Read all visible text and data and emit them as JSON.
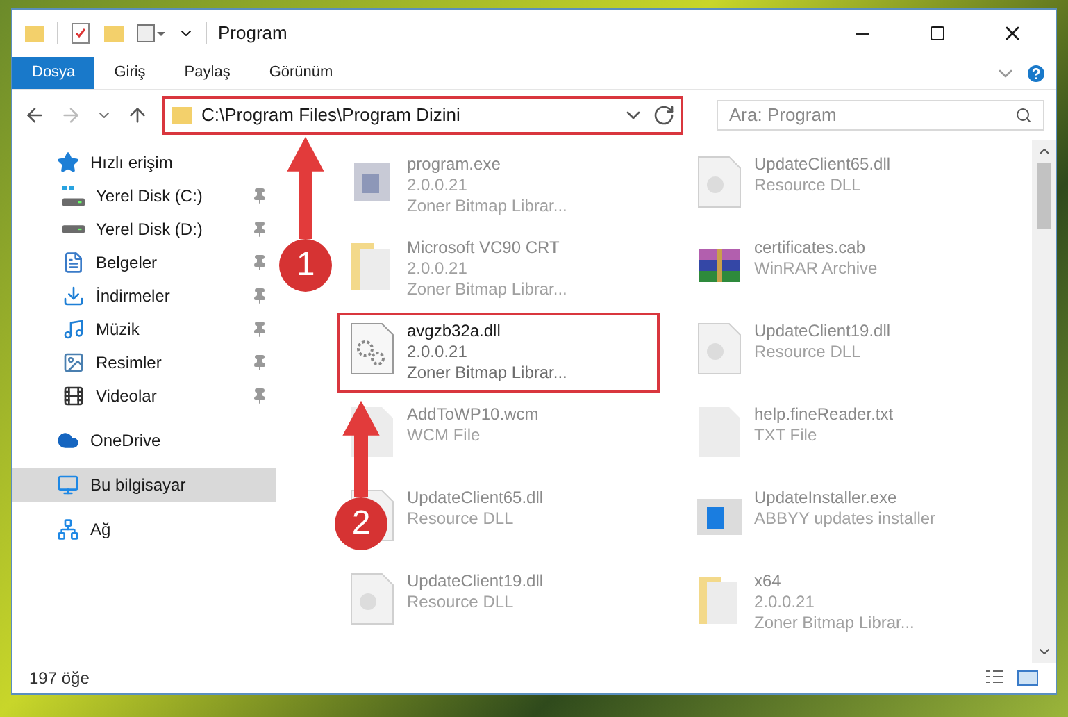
{
  "window": {
    "title": "Program"
  },
  "ribbon": {
    "tabs": [
      {
        "label": "Dosya",
        "selected": true
      },
      {
        "label": "Giriş",
        "selected": false
      },
      {
        "label": "Paylaş",
        "selected": false
      },
      {
        "label": "Görünüm",
        "selected": false
      }
    ]
  },
  "address_bar": {
    "path": "C:\\Program Files\\Program Dizini",
    "highlighted": true
  },
  "search": {
    "placeholder": "Ara: Program"
  },
  "sidebar": {
    "items": [
      {
        "label": "Hızlı erişim",
        "kind": "star",
        "selected": false,
        "children": [
          {
            "label": "Yerel Disk (C:)",
            "kind": "drive-win",
            "pinned": true,
            "selected": false
          },
          {
            "label": "Yerel Disk (D:)",
            "kind": "drive",
            "pinned": true,
            "selected": false
          },
          {
            "label": "Belgeler",
            "kind": "document",
            "pinned": true,
            "selected": false
          },
          {
            "label": "İndirmeler",
            "kind": "download",
            "pinned": true,
            "selected": false
          },
          {
            "label": "Müzik",
            "kind": "music",
            "pinned": true,
            "selected": false
          },
          {
            "label": "Resimler",
            "kind": "image",
            "pinned": true,
            "selected": false
          },
          {
            "label": "Videolar",
            "kind": "film",
            "pinned": true,
            "selected": false
          }
        ]
      },
      {
        "label": "OneDrive",
        "kind": "cloud",
        "selected": false
      },
      {
        "label": "Bu bilgisayar",
        "kind": "monitor",
        "selected": true
      },
      {
        "label": "Ağ",
        "kind": "network",
        "selected": false
      }
    ]
  },
  "files": [
    {
      "name": "program.exe",
      "details": [
        "2.0.0.21",
        "Zoner Bitmap Librar..."
      ],
      "kind": "exe",
      "highlighted": false
    },
    {
      "name": "UpdateClient65.dll",
      "details": [
        "Resource DLL"
      ],
      "kind": "dll",
      "highlighted": false
    },
    {
      "name": "Microsoft VC90 CRT",
      "details": [
        "2.0.0.21",
        "Zoner Bitmap Librar..."
      ],
      "kind": "folder",
      "highlighted": false
    },
    {
      "name": "certificates.cab",
      "details": [
        "WinRAR Archive"
      ],
      "kind": "archive",
      "highlighted": false
    },
    {
      "name": "avgzb32a.dll",
      "details": [
        "2.0.0.21",
        "Zoner Bitmap Librar..."
      ],
      "kind": "gears",
      "highlighted": true
    },
    {
      "name": "UpdateClient19.dll",
      "details": [
        "Resource DLL"
      ],
      "kind": "dll",
      "highlighted": false
    },
    {
      "name": "AddToWP10.wcm",
      "details": [
        "WCM File"
      ],
      "kind": "blank",
      "highlighted": false
    },
    {
      "name": "help.fineReader.txt",
      "details": [
        "TXT File"
      ],
      "kind": "blank",
      "highlighted": false
    },
    {
      "name": "UpdateClient65.dll",
      "details": [
        "Resource DLL"
      ],
      "kind": "dll",
      "highlighted": false
    },
    {
      "name": "UpdateInstaller.exe",
      "details": [
        "ABBYY updates installer"
      ],
      "kind": "installer",
      "highlighted": false
    },
    {
      "name": "UpdateClient19.dll",
      "details": [
        "Resource DLL"
      ],
      "kind": "dll",
      "highlighted": false
    },
    {
      "name": "x64",
      "details": [
        "2.0.0.21",
        "Zoner Bitmap Librar..."
      ],
      "kind": "folder",
      "highlighted": false
    }
  ],
  "annotations": [
    {
      "number": "1"
    },
    {
      "number": "2"
    }
  ],
  "status_bar": {
    "count": "197 öğe"
  }
}
